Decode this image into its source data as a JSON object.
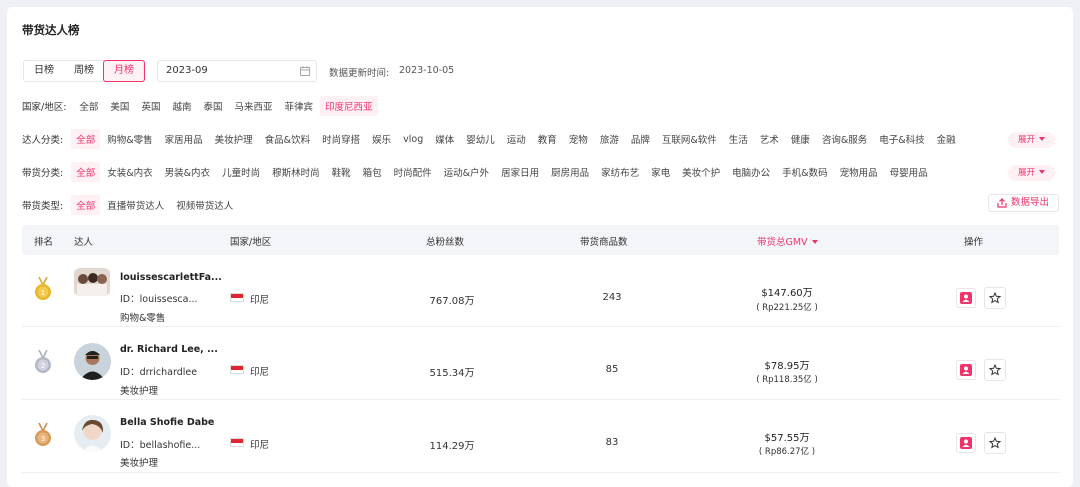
{
  "page": {
    "title": "带货达人榜"
  },
  "period_tabs": [
    {
      "label": "日榜",
      "active": false
    },
    {
      "label": "周榜",
      "active": false
    },
    {
      "label": "月榜",
      "active": true
    }
  ],
  "date_picker": {
    "value": "2023-09",
    "icon": "calendar-icon"
  },
  "update_time": {
    "label": "数据更新时间:",
    "value": "2023-10-05"
  },
  "filters": {
    "region": {
      "label": "国家/地区:",
      "options": [
        "全部",
        "美国",
        "英国",
        "越南",
        "泰国",
        "马来西亚",
        "菲律宾",
        "印度尼西亚"
      ],
      "active": "印度尼西亚"
    },
    "creator_category": {
      "label": "达人分类:",
      "options": [
        "全部",
        "购物&零售",
        "家居用品",
        "美妆护理",
        "食品&饮料",
        "时尚穿搭",
        "娱乐",
        "vlog",
        "媒体",
        "婴幼儿",
        "运动",
        "教育",
        "宠物",
        "旅游",
        "品牌",
        "互联网&软件",
        "生活",
        "艺术",
        "健康",
        "咨询&服务",
        "电子&科技",
        "金融"
      ],
      "active": "全部",
      "expand_label": "展开"
    },
    "goods_category": {
      "label": "带货分类:",
      "options": [
        "全部",
        "女装&内衣",
        "男装&内衣",
        "儿童时尚",
        "穆斯林时尚",
        "鞋靴",
        "箱包",
        "时尚配件",
        "运动&户外",
        "居家日用",
        "厨房用品",
        "家纺布艺",
        "家电",
        "美妆个护",
        "电脑办公",
        "手机&数码",
        "宠物用品",
        "母婴用品"
      ],
      "active": "全部",
      "expand_label": "展开"
    },
    "sales_type": {
      "label": "带货类型:",
      "options": [
        "全部",
        "直播带货达人",
        "视频带货达人"
      ],
      "active": "全部"
    }
  },
  "export_button": {
    "label": "数据导出",
    "icon": "export-icon"
  },
  "table": {
    "headers": {
      "rank": "排名",
      "creator": "达人",
      "region": "国家/地区",
      "fans": "总粉丝数",
      "goods": "带货商品数",
      "gmv": "带货总GMV",
      "actions": "操作"
    },
    "sorted_by": "gmv",
    "rows": [
      {
        "rank": 1,
        "medal_color": "#e8b52c",
        "name": "louissescarlettFa...",
        "id": "ID：louissesca...",
        "category": "购物&零售",
        "country": "印尼",
        "fans": "767.08万",
        "goods": "243",
        "gmv": "$147.60万",
        "gmv_local": "( Rp221.25亿 )"
      },
      {
        "rank": 2,
        "medal_color": "#b3b7c6",
        "name": "dr. Richard Lee, ...",
        "id": "ID：drrichardlee",
        "category": "美妆护理",
        "country": "印尼",
        "fans": "515.34万",
        "goods": "85",
        "gmv": "$78.95万",
        "gmv_local": "( Rp118.35亿 )"
      },
      {
        "rank": 3,
        "medal_color": "#d89a5a",
        "name": "Bella Shofie Dabe",
        "id": "ID：bellashofie...",
        "category": "美妆护理",
        "country": "印尼",
        "fans": "114.29万",
        "goods": "83",
        "gmv": "$57.55万",
        "gmv_local": "( Rp86.27亿 )"
      }
    ]
  },
  "colors": {
    "accent": "#f0346a",
    "accent_bg": "#fff0f4",
    "header_bg": "#f4f5f9"
  }
}
